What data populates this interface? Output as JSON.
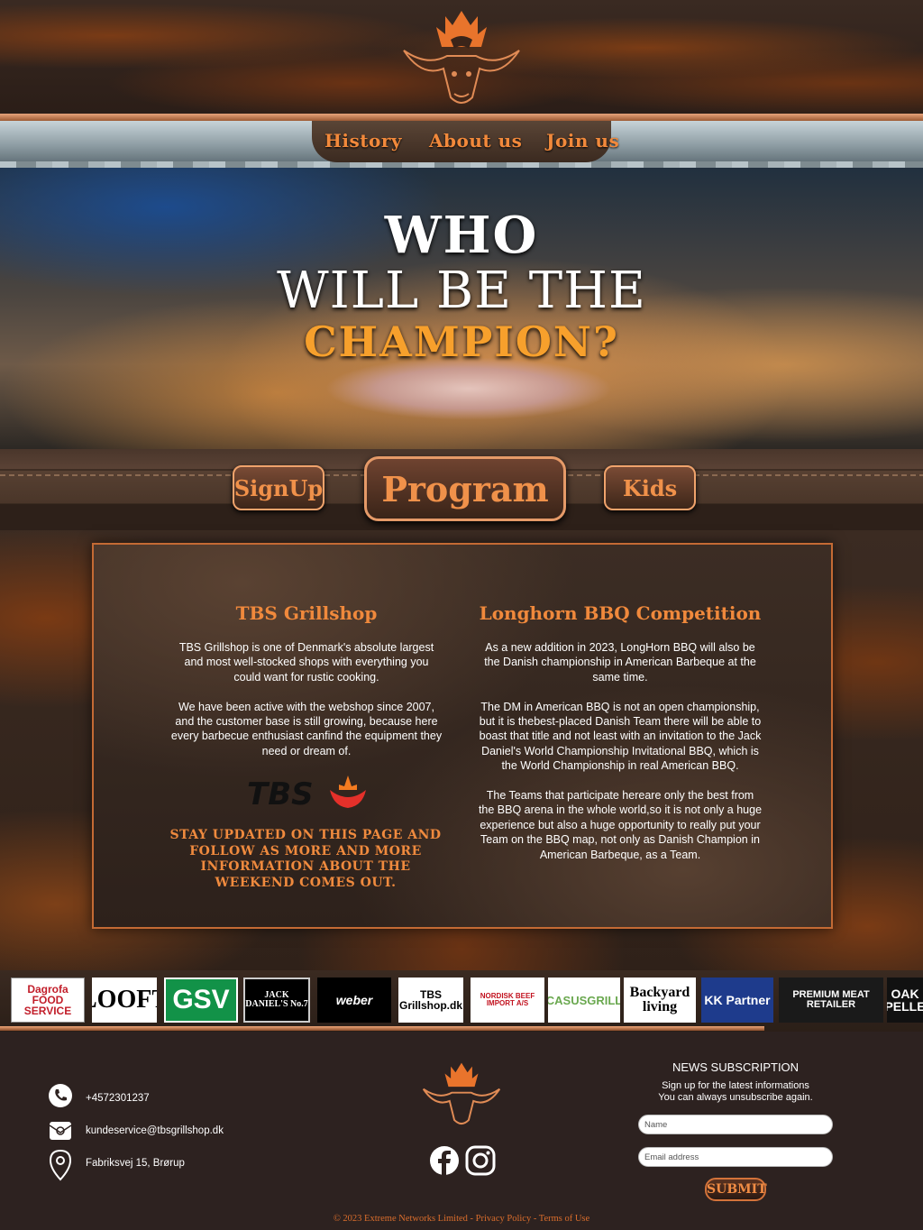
{
  "nav": {
    "history": "History",
    "about": "About us",
    "join": "Join us"
  },
  "hero": {
    "line1": "WHO",
    "line2": "WILL BE THE",
    "line3": "CHAMPION?"
  },
  "buttons": {
    "signup": "SignUp",
    "program": "Program",
    "kids": "Kids"
  },
  "left_col": {
    "title": "TBS Grillshop",
    "text": "TBS Grillshop is one of Denmark's absolute largest and most well-stocked shops with everything you could want for rustic cooking.\n\nWe have been active with the webshop since 2007, and the customer base is still growing, because here every barbecue enthusiast canfind the equipment they need or dream of.",
    "logo_text": "TBS",
    "stay_updated": "Stay updated on this page and follow as more and more information about the weekend comes out."
  },
  "right_col": {
    "title": "Longhorn BBQ Competition",
    "text": "As a new addition in 2023, LongHorn BBQ will also be the Danish championship in American Barbeque at the same time.\n\nThe DM in American BBQ is not an open championship, but it is thebest-placed Danish Team there will be able to boast that title and not least with an invitation to the Jack Daniel's World Championship Invitational BBQ, which is the World Championship in real American BBQ.\n\nThe Teams that participate hereare only the best from the BBQ arena in the whole world,so it is not only a huge experience but also a huge opportunity to really put your Team on the BBQ map, not only as Danish Champion in American Barbeque, as a Team."
  },
  "sponsors": [
    {
      "label": "Dagrofa FOOD SERVICE"
    },
    {
      "label": "LOOFT"
    },
    {
      "label": "GSV"
    },
    {
      "label": "JACK DANIEL'S No.7"
    },
    {
      "label": "weber"
    },
    {
      "label": "TBS Grillshop.dk"
    },
    {
      "label": "NORDISK BEEF IMPORT A/S"
    },
    {
      "label": "CASUSGRILL"
    },
    {
      "label": "Backyard living"
    },
    {
      "label": "KK Partner"
    },
    {
      "label": "PREMIUM MEAT RETAILER"
    },
    {
      "label": "OAK PELLE"
    }
  ],
  "footer": {
    "phone": "+4572301237",
    "email": "kundeservice@tbsgrillshop.dk",
    "address": "Fabriksvej 15, Brørup",
    "news_title": "NEWS SUBSCRIPTION",
    "news_desc": "Sign up for the latest informations\nYou can always unsubscribe again.",
    "name_placeholder": "Name",
    "email_placeholder": "Email address",
    "submit": "SUBMIT",
    "copyright": "© 2023 Extreme Networks Limited - Privacy Policy - Terms of Use"
  },
  "colors": {
    "accent": "#f0893c",
    "dark_bg": "#2d2220",
    "hero_highlight": "#f7a02c"
  }
}
